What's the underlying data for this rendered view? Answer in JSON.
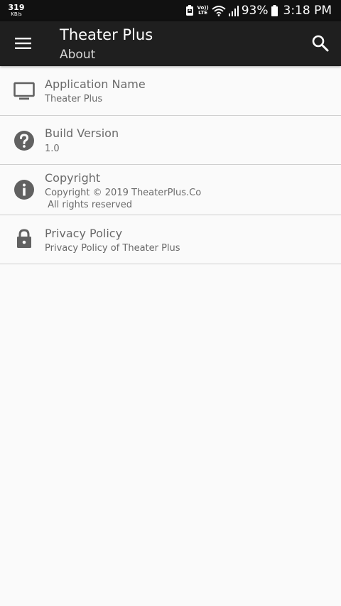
{
  "status_bar": {
    "net_speed": "319",
    "net_speed_unit": "KB/s",
    "lte_line1": "Vo))",
    "lte_line2": "LTE",
    "battery_percent": "93%",
    "time": "3:18 PM"
  },
  "app_bar": {
    "title": "Theater Plus",
    "subtitle": "About",
    "menu_icon": "hamburger-menu-icon",
    "search_icon": "magnifier-search-icon",
    "background_color": "#1f1f1f"
  },
  "about_items": [
    {
      "icon": "tv-monitor-icon",
      "title": "Application Name",
      "subtitle": "Theater Plus"
    },
    {
      "icon": "help-question-icon",
      "title": "Build Version",
      "subtitle": "1.0"
    },
    {
      "icon": "info-icon",
      "title": "Copyright",
      "subtitle": "Copyright © 2019 TheaterPlus.Co\n All rights reserved"
    },
    {
      "icon": "lock-icon",
      "title": "Privacy Policy",
      "subtitle": "Privacy Policy of Theater Plus"
    }
  ],
  "colors": {
    "icon_gray": "#616161",
    "text_gray": "#6a6a6a",
    "divider": "#cfcfcf",
    "list_background": "#fafafa"
  }
}
